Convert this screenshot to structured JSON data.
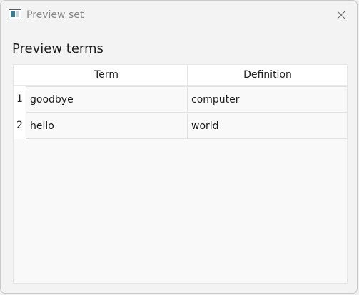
{
  "window": {
    "title": "Preview set",
    "icon": "app-window-icon",
    "close_icon": "close-icon"
  },
  "heading": "Preview terms",
  "table": {
    "columns": [
      "Term",
      "Definition"
    ],
    "rows": [
      {
        "index": "1",
        "term": "goodbye",
        "definition": "computer"
      },
      {
        "index": "2",
        "term": "hello",
        "definition": "world"
      }
    ]
  }
}
